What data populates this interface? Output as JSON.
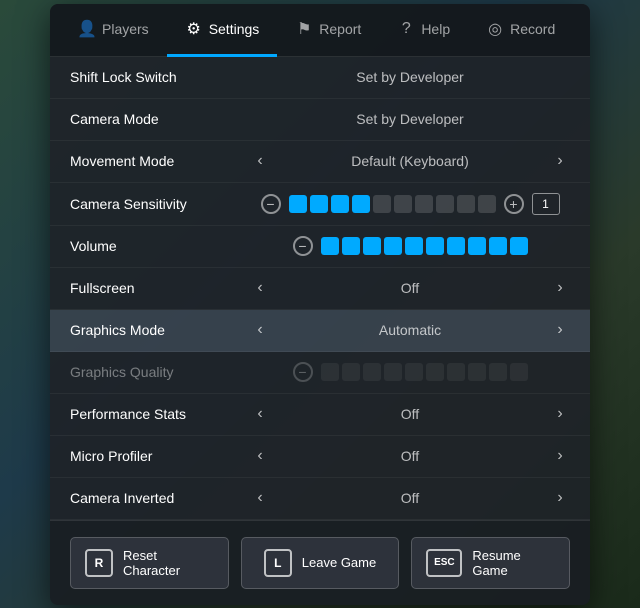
{
  "tabs": [
    {
      "id": "players",
      "label": "Players",
      "icon": "👤",
      "active": false
    },
    {
      "id": "settings",
      "label": "Settings",
      "icon": "⚙",
      "active": true
    },
    {
      "id": "report",
      "label": "Report",
      "icon": "⚑",
      "active": false
    },
    {
      "id": "help",
      "label": "Help",
      "icon": "?",
      "active": false
    },
    {
      "id": "record",
      "label": "Record",
      "icon": "◎",
      "active": false
    }
  ],
  "settings": [
    {
      "id": "shift-lock",
      "label": "Shift Lock Switch",
      "value": "Set by Developer",
      "type": "static",
      "dimmed": false,
      "highlighted": false
    },
    {
      "id": "camera-mode",
      "label": "Camera Mode",
      "value": "Set by Developer",
      "type": "static",
      "dimmed": false,
      "highlighted": false
    },
    {
      "id": "movement-mode",
      "label": "Movement Mode",
      "value": "Default (Keyboard)",
      "type": "arrows",
      "dimmed": false,
      "highlighted": false
    },
    {
      "id": "camera-sensitivity",
      "label": "Camera Sensitivity",
      "value": "",
      "type": "slider",
      "filled": 4,
      "total": 10,
      "extraPlus": true,
      "valueBox": "1",
      "dimmed": false,
      "highlighted": false
    },
    {
      "id": "volume",
      "label": "Volume",
      "value": "",
      "type": "slider",
      "filled": 10,
      "total": 10,
      "extraPlus": false,
      "valueBox": null,
      "dimmed": false,
      "highlighted": false
    },
    {
      "id": "fullscreen",
      "label": "Fullscreen",
      "value": "Off",
      "type": "arrows",
      "dimmed": false,
      "highlighted": false
    },
    {
      "id": "graphics-mode",
      "label": "Graphics Mode",
      "value": "Automatic",
      "type": "arrows",
      "dimmed": false,
      "highlighted": true
    },
    {
      "id": "graphics-quality",
      "label": "Graphics Quality",
      "value": "",
      "type": "slider",
      "filled": 0,
      "total": 10,
      "extraPlus": false,
      "valueBox": null,
      "dimmed": true,
      "highlighted": false
    },
    {
      "id": "performance-stats",
      "label": "Performance Stats",
      "value": "Off",
      "type": "arrows",
      "dimmed": false,
      "highlighted": false
    },
    {
      "id": "micro-profiler",
      "label": "Micro Profiler",
      "value": "Off",
      "type": "arrows",
      "dimmed": false,
      "highlighted": false
    },
    {
      "id": "camera-inverted",
      "label": "Camera Inverted",
      "value": "Off",
      "type": "arrows",
      "dimmed": false,
      "highlighted": false
    }
  ],
  "footer": {
    "buttons": [
      {
        "id": "reset",
        "key": "R",
        "label": "Reset Character"
      },
      {
        "id": "leave",
        "key": "L",
        "label": "Leave Game"
      },
      {
        "id": "resume",
        "key": "ESC",
        "label": "Resume Game"
      }
    ]
  }
}
